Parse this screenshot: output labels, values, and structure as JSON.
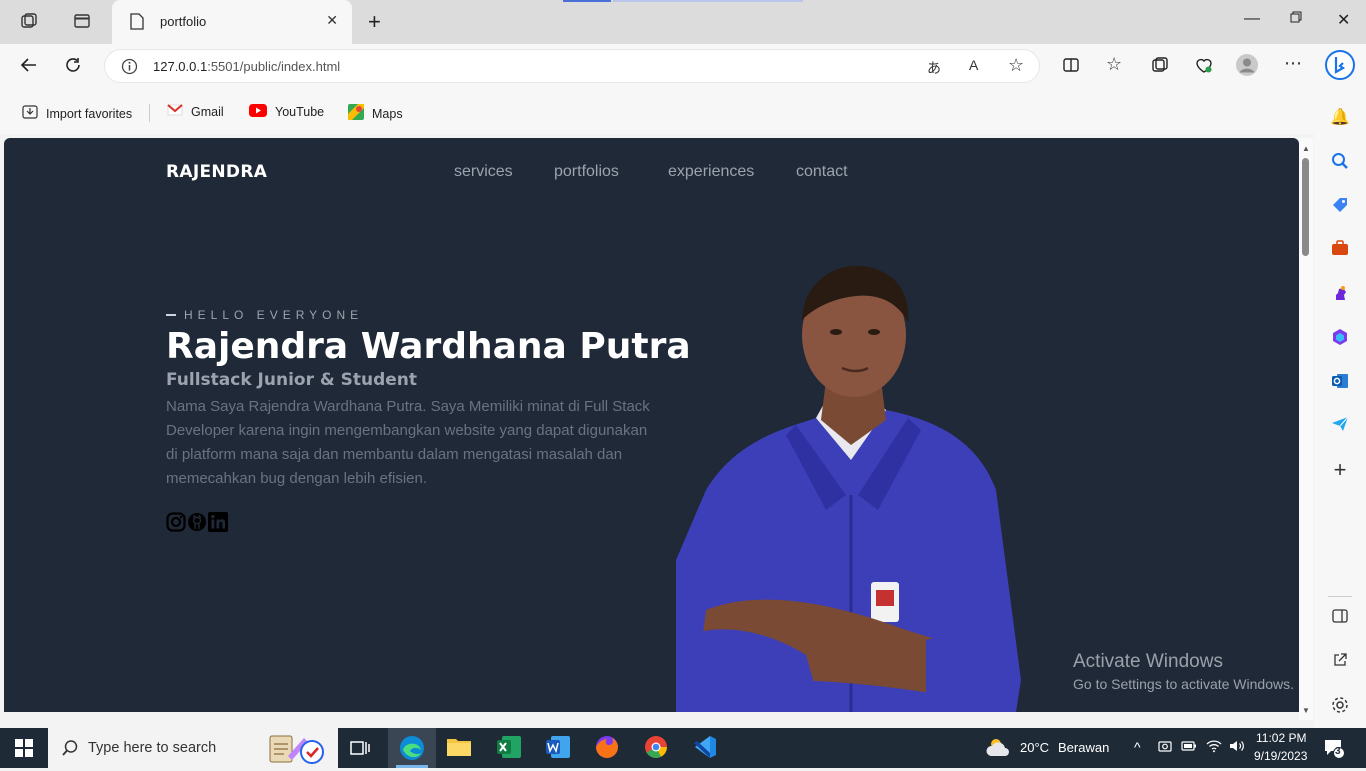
{
  "browser": {
    "tab_title": "portfolio",
    "url_host": "127.0.0.1",
    "url_rest": ":5501/public/index.html",
    "favorites": [
      {
        "label": "Import favorites",
        "icon": "import-favorites-icon"
      },
      {
        "label": "Gmail",
        "icon": "gmail-icon"
      },
      {
        "label": "YouTube",
        "icon": "youtube-icon"
      },
      {
        "label": "Maps",
        "icon": "maps-icon"
      }
    ]
  },
  "site": {
    "brand": "RAJENDRA",
    "nav": [
      "services",
      "portfolios",
      "experiences",
      "contact"
    ],
    "kicker": "HELLO EVERYONE",
    "name": "Rajendra Wardhana Putra",
    "subtitle": "Fullstack Junior & Student",
    "description": "Nama Saya Rajendra Wardhana Putra. Saya Memiliki minat di Full Stack Developer karena ingin mengembangkan website yang dapat digunakan di platform mana saja dan membantu dalam mengatasi masalah dan memecahkan bug dengan lebih efisien.",
    "socials": [
      "instagram-icon",
      "github-icon",
      "linkedin-icon"
    ],
    "colors": {
      "background": "#1f2937",
      "muted": "#9ca3af",
      "text": "#ffffff"
    }
  },
  "watermark": {
    "title": "Activate Windows",
    "subtitle": "Go to Settings to activate Windows."
  },
  "taskbar": {
    "search_placeholder": "Type here to search",
    "weather_temp": "20°C",
    "weather_text": "Berawan",
    "time": "11:02 PM",
    "date": "9/19/2023",
    "notification_count": "3"
  }
}
